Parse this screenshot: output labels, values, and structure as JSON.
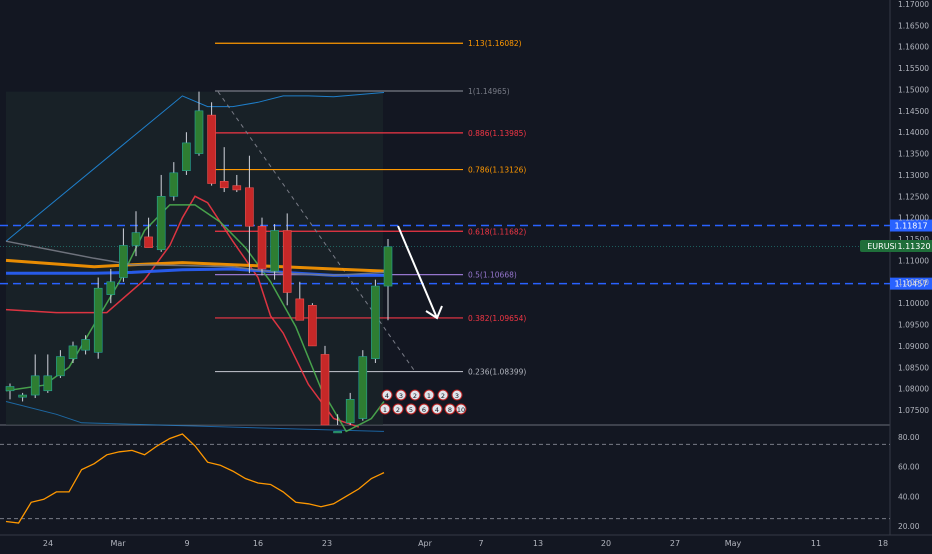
{
  "chart_data": {
    "type": "candlestick",
    "symbol": "EURUSD",
    "last_price": "1.11320",
    "price_axis": {
      "range": [
        1.0705,
        1.1713
      ],
      "ticks": [
        "1.17000",
        "1.16500",
        "1.16000",
        "1.15500",
        "1.15000",
        "1.14500",
        "1.14000",
        "1.13500",
        "1.13000",
        "1.12500",
        "1.12000",
        "1.11500",
        "1.11000",
        "1.10500",
        "1.10000",
        "1.09500",
        "1.09000",
        "1.08500",
        "1.08000",
        "1.07500"
      ]
    },
    "date_axis": [
      "24",
      "Mar",
      "9",
      "16",
      "23",
      "Apr",
      "7",
      "13",
      "20",
      "27",
      "May",
      "11",
      "18"
    ],
    "candles": [
      {
        "date": "2020-02-20",
        "o": 1.0795,
        "h": 1.0812,
        "l": 1.0775,
        "c": 1.0805
      },
      {
        "date": "2020-02-21",
        "o": 1.078,
        "h": 1.079,
        "l": 1.077,
        "c": 1.0785
      },
      {
        "date": "2020-02-24",
        "o": 1.0785,
        "h": 1.088,
        "l": 1.0778,
        "c": 1.083
      },
      {
        "date": "2020-02-25",
        "o": 1.0795,
        "h": 1.088,
        "l": 1.079,
        "c": 1.083
      },
      {
        "date": "2020-02-26",
        "o": 1.083,
        "h": 1.089,
        "l": 1.0825,
        "c": 1.0875
      },
      {
        "date": "2020-02-27",
        "o": 1.087,
        "h": 1.091,
        "l": 1.086,
        "c": 1.09
      },
      {
        "date": "2020-02-28",
        "o": 1.089,
        "h": 1.0925,
        "l": 1.088,
        "c": 1.0915
      },
      {
        "date": "2020-03-02",
        "o": 1.0885,
        "h": 1.106,
        "l": 1.087,
        "c": 1.1035
      },
      {
        "date": "2020-03-03",
        "o": 1.102,
        "h": 1.108,
        "l": 1.1,
        "c": 1.105
      },
      {
        "date": "2020-03-04",
        "o": 1.106,
        "h": 1.1175,
        "l": 1.105,
        "c": 1.1135
      },
      {
        "date": "2020-03-05",
        "o": 1.1135,
        "h": 1.1215,
        "l": 1.111,
        "c": 1.1165
      },
      {
        "date": "2020-03-06",
        "o": 1.1155,
        "h": 1.12,
        "l": 1.113,
        "c": 1.113
      },
      {
        "date": "2020-03-09",
        "o": 1.1125,
        "h": 1.13,
        "l": 1.112,
        "c": 1.125
      },
      {
        "date": "2020-03-10",
        "o": 1.125,
        "h": 1.133,
        "l": 1.124,
        "c": 1.1305
      },
      {
        "date": "2020-03-11",
        "o": 1.131,
        "h": 1.14,
        "l": 1.13,
        "c": 1.1375
      },
      {
        "date": "2020-03-12",
        "o": 1.135,
        "h": 1.1495,
        "l": 1.1345,
        "c": 1.145
      },
      {
        "date": "2020-03-13",
        "o": 1.144,
        "h": 1.147,
        "l": 1.1275,
        "c": 1.128
      },
      {
        "date": "2020-03-16",
        "o": 1.1285,
        "h": 1.1365,
        "l": 1.126,
        "c": 1.127
      },
      {
        "date": "2020-03-17",
        "o": 1.1275,
        "h": 1.13,
        "l": 1.126,
        "c": 1.1265
      },
      {
        "date": "2020-03-18",
        "o": 1.127,
        "h": 1.1345,
        "l": 1.107,
        "c": 1.118
      },
      {
        "date": "2020-03-19",
        "o": 1.118,
        "h": 1.12,
        "l": 1.1065,
        "c": 1.108
      },
      {
        "date": "2020-03-20",
        "o": 1.1075,
        "h": 1.1185,
        "l": 1.1055,
        "c": 1.117
      },
      {
        "date": "2020-03-23",
        "o": 1.117,
        "h": 1.121,
        "l": 1.0995,
        "c": 1.1025
      },
      {
        "date": "2020-03-24",
        "o": 1.101,
        "h": 1.105,
        "l": 1.096,
        "c": 1.096
      },
      {
        "date": "2020-03-25",
        "o": 1.0995,
        "h": 1.1,
        "l": 1.09,
        "c": 1.09
      },
      {
        "date": "2020-03-26",
        "o": 1.088,
        "h": 1.09,
        "l": 1.064,
        "c": 1.068
      },
      {
        "date": "2020-03-27",
        "o": 1.07,
        "h": 1.074,
        "l": 1.0635,
        "c": 1.07
      },
      {
        "date": "2020-03-30",
        "o": 1.072,
        "h": 1.079,
        "l": 1.07,
        "c": 1.0775
      },
      {
        "date": "2020-03-31",
        "o": 1.073,
        "h": 1.089,
        "l": 1.0725,
        "c": 1.0875
      },
      {
        "date": "2020-04-01",
        "o": 1.087,
        "h": 1.1055,
        "l": 1.086,
        "c": 1.104
      },
      {
        "date": "2020-04-02",
        "o": 1.104,
        "h": 1.115,
        "l": 1.096,
        "c": 1.1132
      }
    ],
    "fibonacci": [
      {
        "label": "1.13(1.16082)",
        "price": 1.16082,
        "color": "#ff9800"
      },
      {
        "label": "1(1.14965)",
        "price": 1.14965,
        "color": "#787b86"
      },
      {
        "label": "0.886(1.13985)",
        "price": 1.13985,
        "color": "#f23645"
      },
      {
        "label": "0.786(1.13126)",
        "price": 1.13126,
        "color": "#ff9800"
      },
      {
        "label": "0.618(1.11682)",
        "price": 1.11682,
        "color": "#f23645"
      },
      {
        "label": "0.5(1.10668)",
        "price": 1.10668,
        "color": "#9575cd"
      },
      {
        "label": "0.382(1.09654)",
        "price": 1.09654,
        "color": "#f23645"
      },
      {
        "label": "0.236(1.08399)",
        "price": 1.08399,
        "color": "#b2b5be"
      }
    ],
    "horizontal_lines": [
      {
        "label": "1.11817",
        "price": 1.11817,
        "color": "#2962ff"
      },
      {
        "label": "1.10457",
        "price": 1.10457,
        "color": "#2962ff"
      }
    ],
    "moving_averages": [
      {
        "color": "#f23645",
        "values": [
          [
            0,
            1.0985
          ],
          [
            4,
            1.0978
          ],
          [
            8,
            1.0978
          ],
          [
            11,
            1.1055
          ],
          [
            13,
            1.1135
          ],
          [
            14,
            1.12
          ],
          [
            15,
            1.125
          ],
          [
            16,
            1.1235
          ],
          [
            18,
            1.1145
          ],
          [
            20,
            1.106
          ],
          [
            21,
            1.097
          ],
          [
            22,
            1.093
          ],
          [
            24,
            1.081
          ],
          [
            26,
            1.073
          ],
          [
            28,
            1.071
          ]
        ]
      },
      {
        "color": "#4caf50",
        "values": [
          [
            0,
            1.0795
          ],
          [
            3,
            1.0808
          ],
          [
            5,
            1.085
          ],
          [
            7,
            1.095
          ],
          [
            9,
            1.105
          ],
          [
            11,
            1.117
          ],
          [
            13,
            1.123
          ],
          [
            15,
            1.123
          ],
          [
            17,
            1.119
          ],
          [
            19,
            1.113
          ],
          [
            21,
            1.105
          ],
          [
            23,
            1.0945
          ],
          [
            25,
            1.08
          ],
          [
            27,
            1.07
          ],
          [
            29,
            1.073
          ],
          [
            30,
            1.077
          ]
        ]
      },
      {
        "color": "#ff9800",
        "values": [
          [
            0,
            1.11
          ],
          [
            7,
            1.1085
          ],
          [
            10,
            1.109
          ],
          [
            14,
            1.1095
          ],
          [
            18,
            1.109
          ],
          [
            22,
            1.1085
          ],
          [
            26,
            1.108
          ],
          [
            30,
            1.1075
          ]
        ]
      },
      {
        "color": "#2962ff",
        "values": [
          [
            0,
            1.107
          ],
          [
            7,
            1.107
          ],
          [
            10,
            1.1072
          ],
          [
            14,
            1.1078
          ],
          [
            18,
            1.108
          ],
          [
            22,
            1.1072
          ],
          [
            26,
            1.1065
          ],
          [
            30,
            1.1065
          ]
        ]
      },
      {
        "color": "#787b86",
        "values": [
          [
            0,
            1.1145
          ],
          [
            7,
            1.1105
          ],
          [
            10,
            1.109
          ],
          [
            14,
            1.1088
          ],
          [
            18,
            1.1085
          ],
          [
            22,
            1.107
          ],
          [
            26,
            1.1065
          ],
          [
            30,
            1.1072
          ]
        ]
      }
    ],
    "upper_band": [
      [
        0,
        1.1145
      ],
      [
        14,
        1.1485
      ],
      [
        16,
        1.146
      ],
      [
        18,
        1.146
      ],
      [
        20,
        1.147
      ],
      [
        22,
        1.1485
      ],
      [
        24,
        1.1485
      ],
      [
        26,
        1.1483
      ],
      [
        30,
        1.1493
      ]
    ],
    "lower_band": [
      [
        0,
        1.077
      ],
      [
        4,
        1.074
      ],
      [
        6,
        1.072
      ],
      [
        30,
        1.07
      ]
    ],
    "oscillator": {
      "axis_ticks": [
        "80.00",
        "60.00",
        "40.00",
        "20.00"
      ],
      "range": [
        17,
        86
      ],
      "levels": [
        75,
        25
      ],
      "color": "#ff9800",
      "values": [
        [
          0,
          23
        ],
        [
          1,
          22
        ],
        [
          2,
          36
        ],
        [
          3,
          38
        ],
        [
          4,
          43
        ],
        [
          5,
          43
        ],
        [
          6,
          58
        ],
        [
          7,
          62
        ],
        [
          8,
          68
        ],
        [
          9,
          70
        ],
        [
          10,
          71
        ],
        [
          11,
          68
        ],
        [
          12,
          74
        ],
        [
          13,
          79
        ],
        [
          14,
          82
        ],
        [
          15,
          74
        ],
        [
          16,
          63
        ],
        [
          17,
          61
        ],
        [
          18,
          57
        ],
        [
          19,
          52
        ],
        [
          20,
          49
        ],
        [
          21,
          48
        ],
        [
          22,
          43
        ],
        [
          23,
          36
        ],
        [
          24,
          35
        ],
        [
          25,
          33
        ],
        [
          26,
          35
        ],
        [
          27,
          40
        ],
        [
          28,
          45
        ],
        [
          29,
          52
        ],
        [
          30,
          56
        ]
      ]
    }
  },
  "symbol_badge": "EURUSD",
  "price_badge": "1.11320",
  "marker_numbers": [
    "4",
    "3",
    "2",
    "1",
    "2",
    "3",
    "5",
    "6",
    "8",
    "10"
  ]
}
